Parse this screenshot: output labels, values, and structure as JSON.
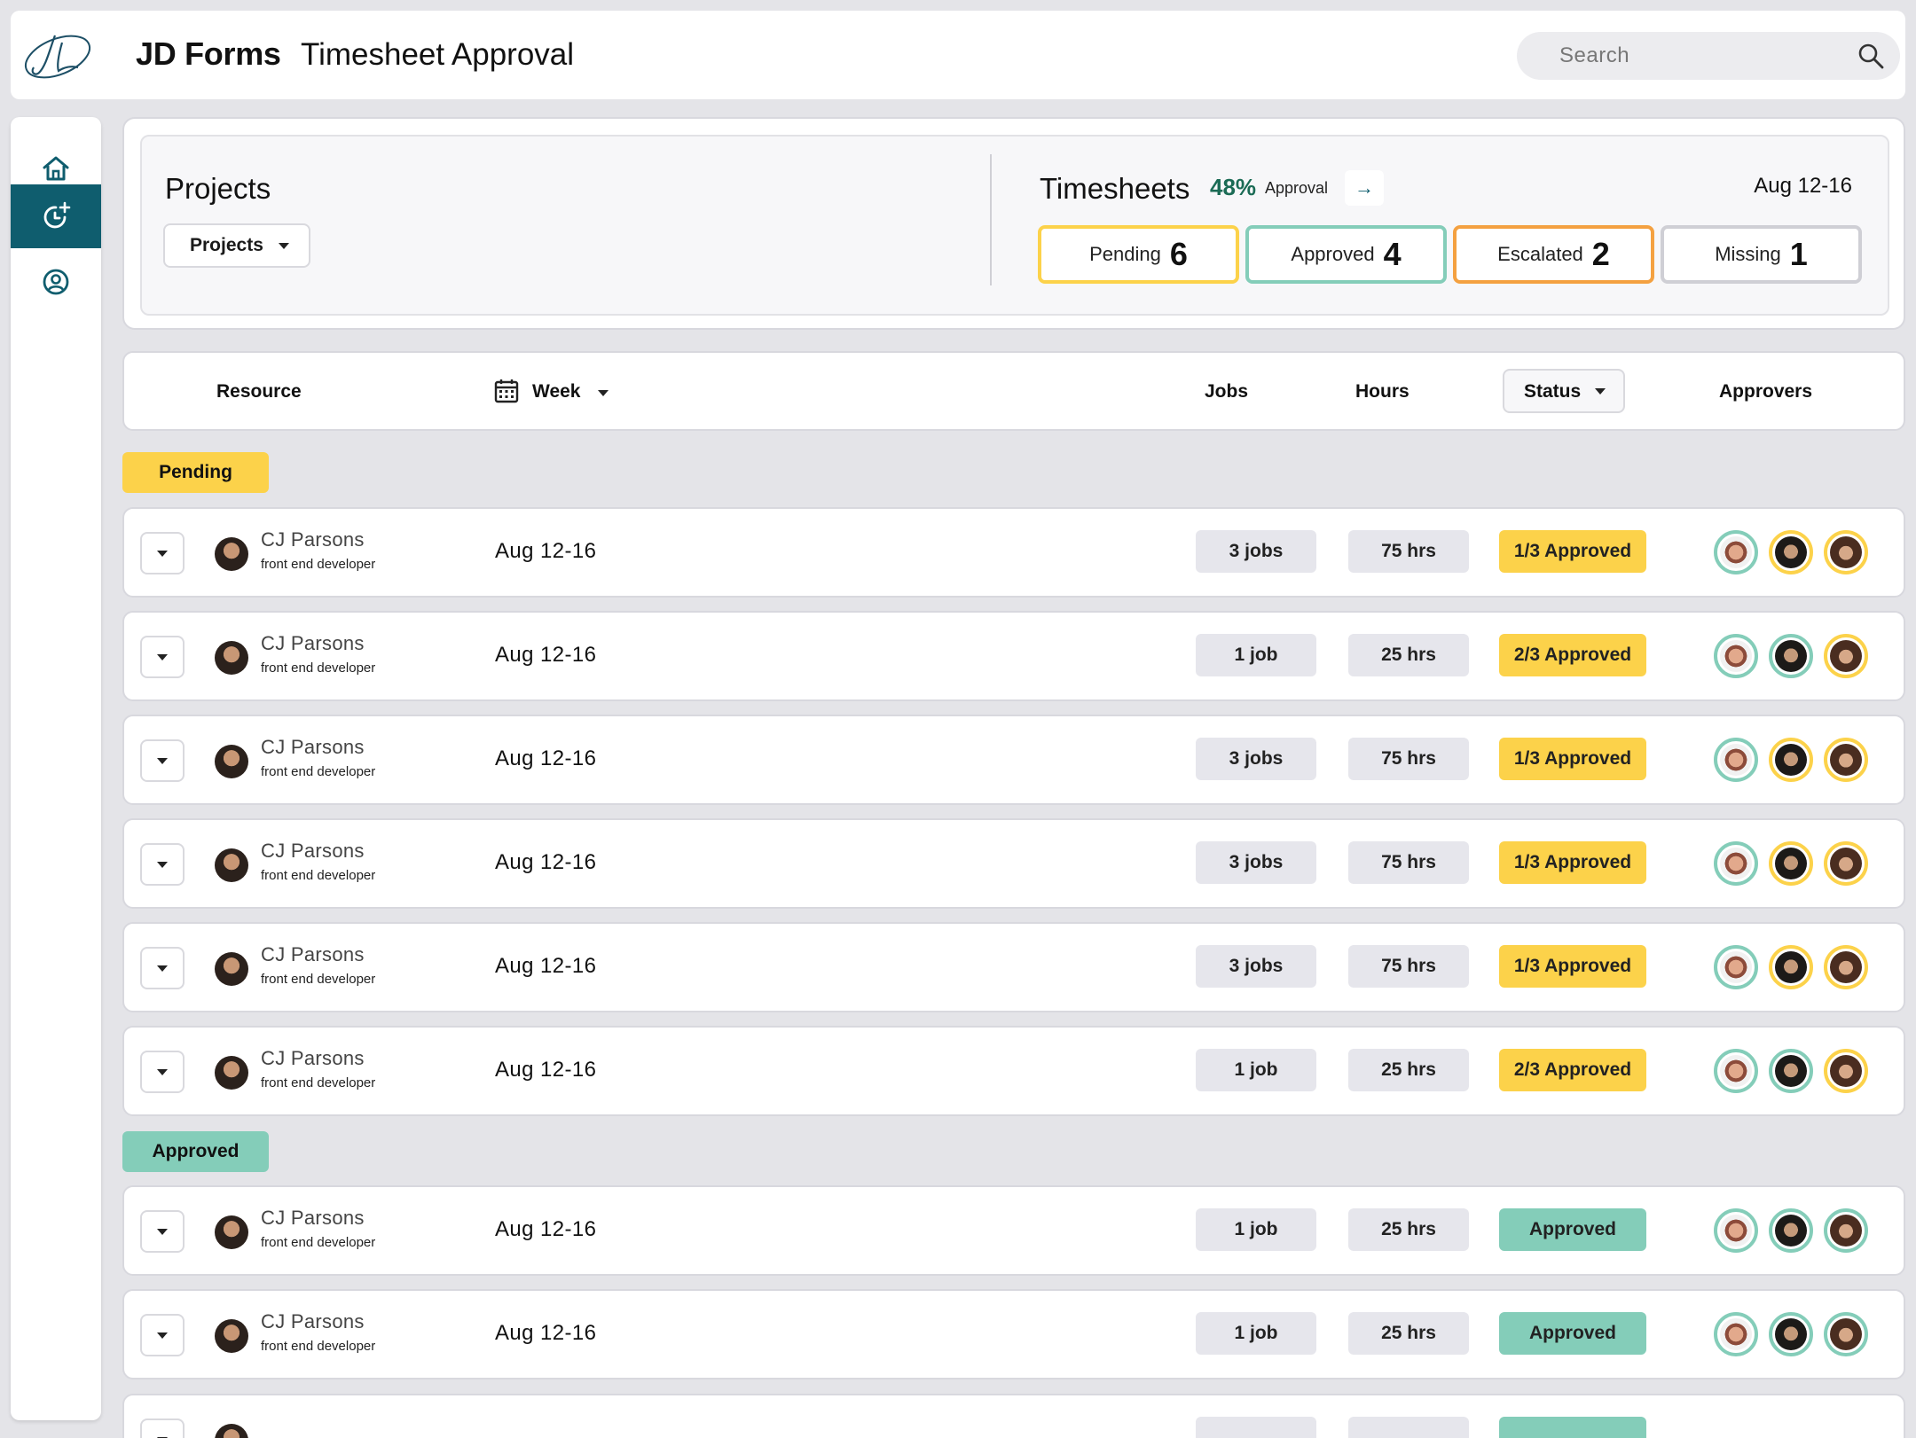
{
  "header": {
    "brand": "JD Forms",
    "title": "Timesheet Approval",
    "search_placeholder": "Search"
  },
  "sidebar": {
    "items": [
      {
        "name": "home",
        "icon": "home-icon",
        "active": false
      },
      {
        "name": "timesheets",
        "icon": "clock-plus-icon",
        "active": true
      },
      {
        "name": "profile",
        "icon": "user-circle-icon",
        "active": false
      }
    ]
  },
  "summary": {
    "projects_title": "Projects",
    "projects_dropdown": "Projects",
    "timesheets_title": "Timesheets",
    "approval_percent": "48%",
    "approval_label": "Approval",
    "arrow": "→",
    "date_range": "Aug 12-16",
    "stats": [
      {
        "label": "Pending",
        "count": "6",
        "color": "#fcd24a"
      },
      {
        "label": "Approved",
        "count": "4",
        "color": "#84cdb9"
      },
      {
        "label": "Escalated",
        "count": "2",
        "color": "#f4a141"
      },
      {
        "label": "Missing",
        "count": "1",
        "color": "#cfcfd5"
      }
    ]
  },
  "columns": {
    "resource": "Resource",
    "week": "Week",
    "jobs": "Jobs",
    "hours": "Hours",
    "status": "Status",
    "approvers": "Approvers"
  },
  "sections": {
    "pending": "Pending",
    "approved": "Approved"
  },
  "colors": {
    "accent": "#0f5d6e",
    "pending": "#fcd24a",
    "approved": "#84cdb9",
    "escalated": "#f4a141",
    "pill_gray": "#e6e6ec"
  },
  "rows": [
    {
      "name": "CJ Parsons",
      "role": "front end developer",
      "week": "Aug 12-16",
      "jobs": "3 jobs",
      "hours": "75 hrs",
      "status": "1/3 Approved"
    },
    {
      "name": "CJ Parsons",
      "role": "front end developer",
      "week": "Aug 12-16",
      "jobs": "1 job",
      "hours": "25 hrs",
      "status": "2/3 Approved"
    },
    {
      "name": "CJ Parsons",
      "role": "front end developer",
      "week": "Aug 12-16",
      "jobs": "3 jobs",
      "hours": "75 hrs",
      "status": "1/3 Approved"
    },
    {
      "name": "CJ Parsons",
      "role": "front end developer",
      "week": "Aug 12-16",
      "jobs": "3 jobs",
      "hours": "75 hrs",
      "status": "1/3 Approved"
    },
    {
      "name": "CJ Parsons",
      "role": "front end developer",
      "week": "Aug 12-16",
      "jobs": "3 jobs",
      "hours": "75 hrs",
      "status": "1/3 Approved"
    },
    {
      "name": "CJ Parsons",
      "role": "front end developer",
      "week": "Aug 12-16",
      "jobs": "1 job",
      "hours": "25 hrs",
      "status": "2/3 Approved"
    },
    {
      "name": "CJ Parsons",
      "role": "front end developer",
      "week": "Aug 12-16",
      "jobs": "1 job",
      "hours": "25 hrs",
      "status": "Approved"
    },
    {
      "name": "CJ Parsons",
      "role": "front end developer",
      "week": "Aug 12-16",
      "jobs": "1 job",
      "hours": "25 hrs",
      "status": "Approved"
    }
  ]
}
